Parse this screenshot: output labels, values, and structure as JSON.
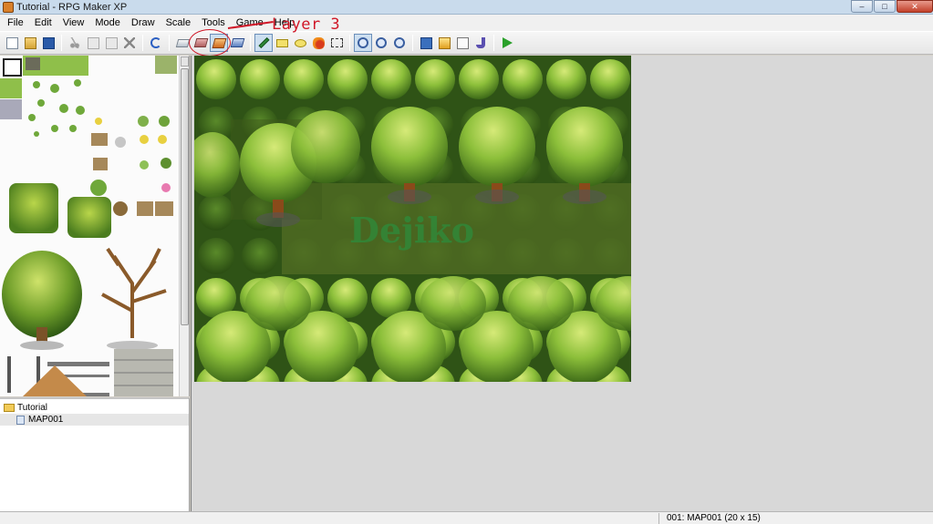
{
  "window": {
    "title": "Tutorial - RPG Maker XP",
    "controls": [
      "–",
      "□",
      "✕"
    ]
  },
  "menu": [
    "File",
    "Edit",
    "View",
    "Mode",
    "Draw",
    "Scale",
    "Tools",
    "Game",
    "Help"
  ],
  "annotation": {
    "text": "Layer 3"
  },
  "toolbar": {
    "buttons": [
      {
        "icon": "new-icon"
      },
      {
        "icon": "open-icon"
      },
      {
        "icon": "save-icon"
      },
      {
        "icon": "cut-icon"
      },
      {
        "icon": "copy-icon"
      },
      {
        "icon": "paste-icon"
      },
      {
        "icon": "delete-icon"
      },
      {
        "icon": "undo-icon"
      },
      {
        "icon": "layer-1-icon"
      },
      {
        "icon": "layer-2-icon"
      },
      {
        "icon": "layer-3-icon",
        "active": true
      },
      {
        "icon": "event-layer-icon"
      },
      {
        "icon": "pencil-icon",
        "active": true
      },
      {
        "icon": "rectangle-icon"
      },
      {
        "icon": "ellipse-icon"
      },
      {
        "icon": "fill-icon"
      },
      {
        "icon": "select-icon"
      },
      {
        "icon": "zoom-1-icon",
        "active": true
      },
      {
        "icon": "zoom-2-icon"
      },
      {
        "icon": "zoom-4-icon"
      },
      {
        "icon": "database-icon"
      },
      {
        "icon": "materialbase-icon"
      },
      {
        "icon": "script-editor-icon"
      },
      {
        "icon": "sound-test-icon"
      },
      {
        "icon": "playtest-icon"
      }
    ]
  },
  "map_tree": {
    "project": "Tutorial",
    "maps": [
      "MAP001"
    ]
  },
  "map": {
    "watermark": "Dejiko"
  },
  "status": {
    "map_info": "001: MAP001 (20 x 15)"
  },
  "colors": {
    "annotation": "#d01828",
    "grass_dark": "#3a5a1a",
    "tree_light": "#b9d64a"
  }
}
